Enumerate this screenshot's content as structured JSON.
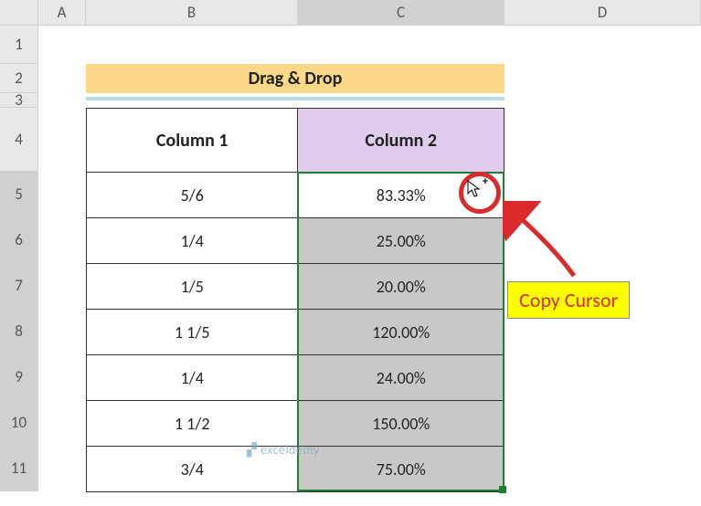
{
  "columns": {
    "A": "A",
    "B": "B",
    "C": "C",
    "D": "D"
  },
  "rows": [
    "1",
    "2",
    "3",
    "4",
    "5",
    "6",
    "7",
    "8",
    "9",
    "10",
    "11"
  ],
  "title": "Drag & Drop",
  "headers": {
    "col1": "Column 1",
    "col2": "Column 2"
  },
  "data": [
    {
      "col1": "5/6",
      "col2": "83.33%"
    },
    {
      "col1": "1/4",
      "col2": "25.00%"
    },
    {
      "col1": "1/5",
      "col2": "20.00%"
    },
    {
      "col1": "1 1/5",
      "col2": "120.00%"
    },
    {
      "col1": "1/4",
      "col2": "24.00%"
    },
    {
      "col1": "1 1/2",
      "col2": "150.00%"
    },
    {
      "col1": "3/4",
      "col2": "75.00%"
    }
  ],
  "callout": "Copy Cursor",
  "watermark": "exceldemy"
}
